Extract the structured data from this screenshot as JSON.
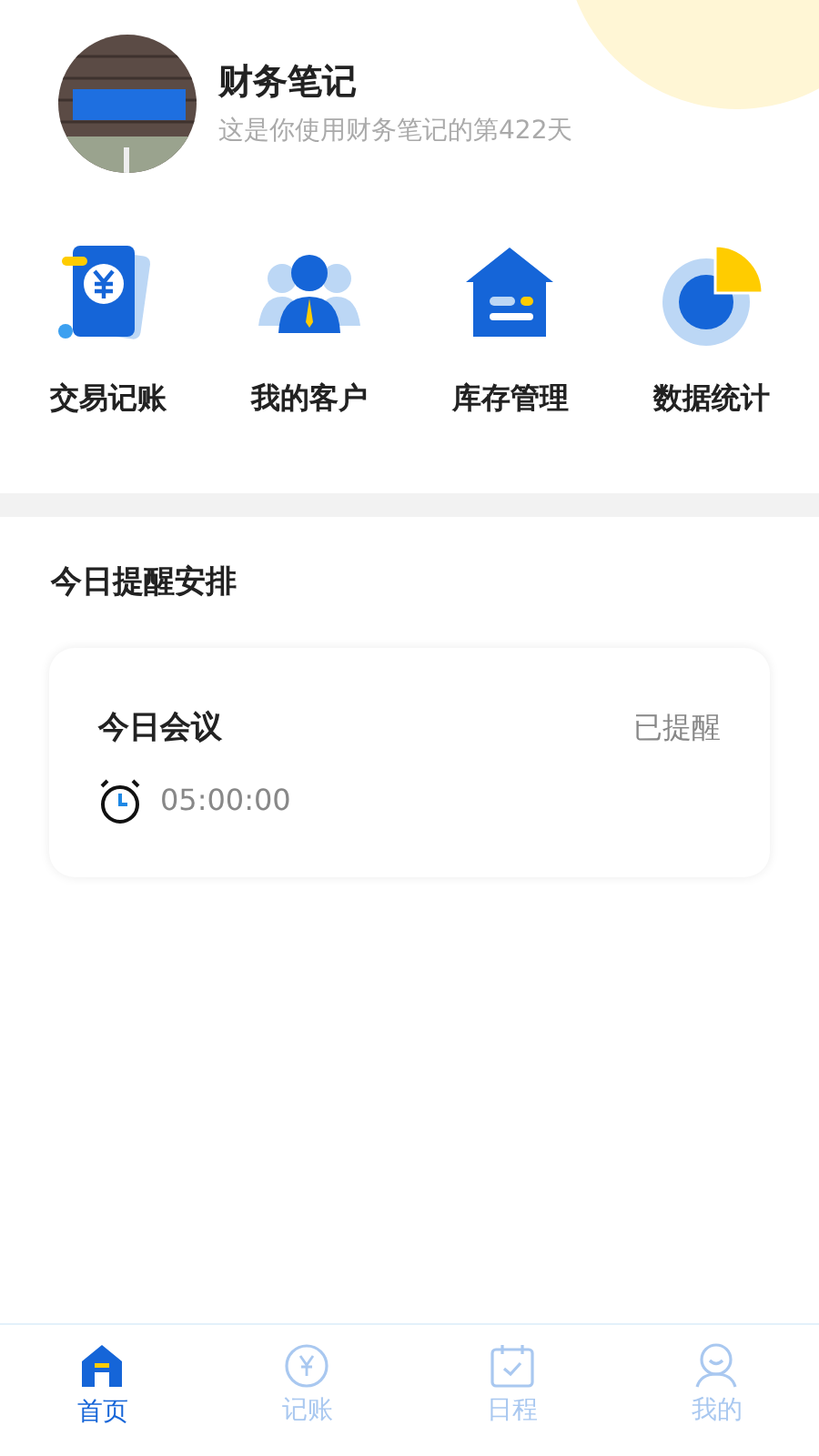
{
  "profile": {
    "name": "财务笔记",
    "subtitle": "这是你使用财务笔记的第422天"
  },
  "shortcuts": [
    {
      "kind": "ledger",
      "label": "交易记账"
    },
    {
      "kind": "customers",
      "label": "我的客户"
    },
    {
      "kind": "inventory",
      "label": "库存管理"
    },
    {
      "kind": "stats",
      "label": "数据统计"
    }
  ],
  "reminders": {
    "title": "今日提醒安排",
    "items": [
      {
        "title": "今日会议",
        "status": "已提醒",
        "time": "05:00:00"
      }
    ]
  },
  "tab_bar": [
    {
      "kind": "home",
      "label": "首页",
      "selected": true
    },
    {
      "kind": "ledger",
      "label": "记账",
      "selected": false
    },
    {
      "kind": "schedule",
      "label": "日程",
      "selected": false
    },
    {
      "kind": "me",
      "label": "我的",
      "selected": false
    }
  ]
}
